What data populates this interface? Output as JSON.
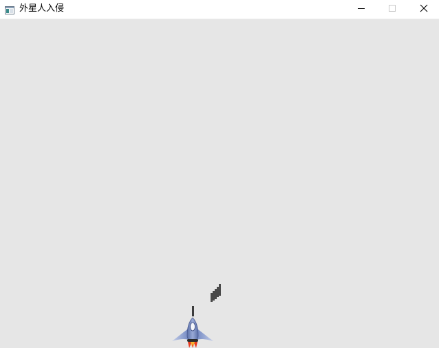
{
  "window": {
    "title": "外星人入侵",
    "icon": "app-window-icon",
    "controls": {
      "minimize_icon": "minimize-icon",
      "maximize_icon": "maximize-icon",
      "close_icon": "close-icon"
    }
  },
  "game": {
    "background_color": "#e6e6e6",
    "ship": {
      "icon": "spaceship-icon",
      "body_color": "#7a8fc4",
      "flame_color": "#e83a1f"
    },
    "bullets": [
      {
        "color": "#3c3c3c"
      }
    ],
    "debris": {
      "icon": "debris-icon",
      "color": "#4a4a4a"
    }
  }
}
